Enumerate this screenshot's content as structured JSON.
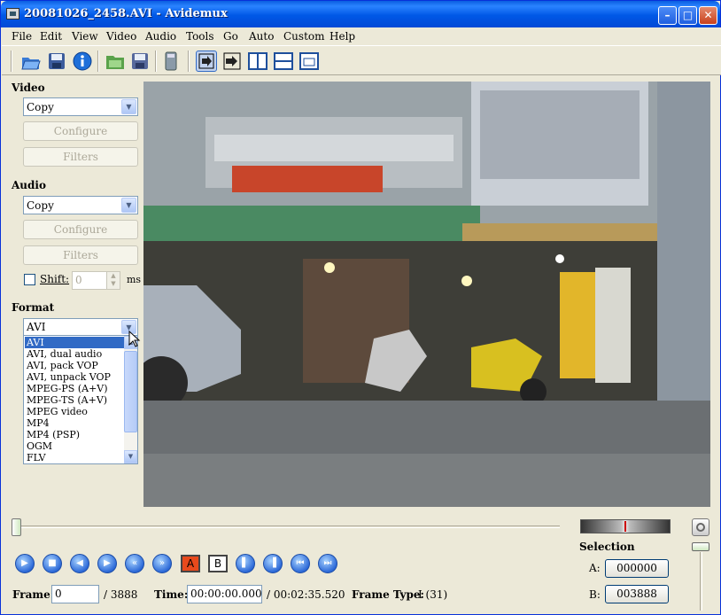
{
  "window": {
    "title": "20081026_2458.AVI - Avidemux",
    "min": "–",
    "max": "□",
    "close": "✕"
  },
  "menu": [
    "File",
    "Edit",
    "View",
    "Video",
    "Audio",
    "Tools",
    "Go",
    "Auto",
    "Custom",
    "Help"
  ],
  "video": {
    "label": "Video",
    "codec": "Copy",
    "configure": "Configure",
    "filters": "Filters"
  },
  "audio": {
    "label": "Audio",
    "codec": "Copy",
    "configure": "Configure",
    "filters": "Filters",
    "shift_label": "Shift:",
    "shift_value": "0",
    "shift_unit": "ms"
  },
  "format": {
    "label": "Format",
    "value": "AVI",
    "options": [
      "AVI",
      "AVI, dual audio",
      "AVI, pack VOP",
      "AVI, unpack VOP",
      "MPEG-PS (A+V)",
      "MPEG-TS (A+V)",
      "MPEG video",
      "MP4",
      "MP4 (PSP)",
      "OGM",
      "FLV"
    ],
    "selected_index": 0
  },
  "controls": {
    "a_marker": "A",
    "b_marker": "B"
  },
  "status": {
    "frame_label": "Frame:",
    "frame_value": "0",
    "frame_total": "/ 3888",
    "time_label": "Time:",
    "time_value": "00:00:00.000",
    "time_total": "/ 00:02:35.520",
    "frame_type_label": "Frame Type:",
    "frame_type_value": "I (31)"
  },
  "selection": {
    "label": "Selection",
    "a_label": "A:",
    "a_value": "000000",
    "b_label": "B:",
    "b_value": "003888"
  },
  "colors": {
    "title_bar": "#0058e6",
    "selected_option": "#316ac5",
    "marker_a": "#e84a1c"
  }
}
